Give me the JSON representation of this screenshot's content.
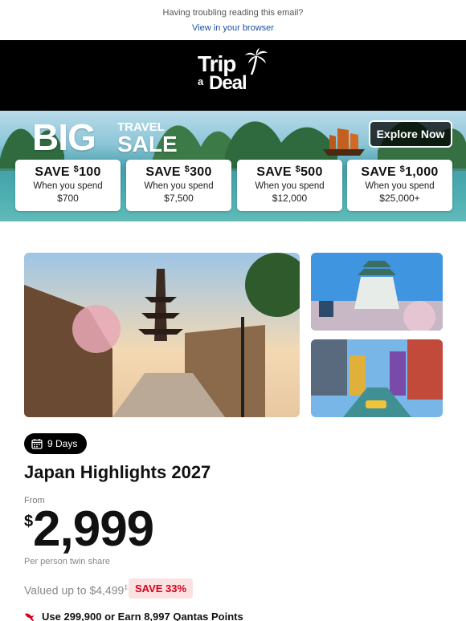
{
  "preheader": {
    "text": "Having troubling reading this email?",
    "link": "View in your browser"
  },
  "brand": {
    "line1": "Trip",
    "line2": "a",
    "line3": "Deal",
    "accent": "#d6001c"
  },
  "banner": {
    "big": "BIG",
    "travel": "TRAVEL",
    "sale": "SALE",
    "explore_button": "Explore Now",
    "tiers": [
      {
        "save_prefix": "SAVE ",
        "currency": "$",
        "amount": "100",
        "spend_label": "When you spend",
        "spend_amount": "$700"
      },
      {
        "save_prefix": "SAVE ",
        "currency": "$",
        "amount": "300",
        "spend_label": "When you spend",
        "spend_amount": "$7,500"
      },
      {
        "save_prefix": "SAVE ",
        "currency": "$",
        "amount": "500",
        "spend_label": "When you spend",
        "spend_amount": "$12,000"
      },
      {
        "save_prefix": "SAVE ",
        "currency": "$",
        "amount": "1,000",
        "spend_label": "When you spend",
        "spend_amount": "$25,000+"
      }
    ]
  },
  "deal": {
    "duration": "9 Days",
    "title": "Japan Highlights 2027",
    "from_label": "From",
    "currency": "$",
    "price": "2,999",
    "price_note": "Per person twin share",
    "valued_text": "Valued up to $4,499",
    "valued_mark": "‡",
    "save_badge": "SAVE 33%",
    "points_text": "Use 299,900 or Earn 8,997 Qantas Points"
  }
}
